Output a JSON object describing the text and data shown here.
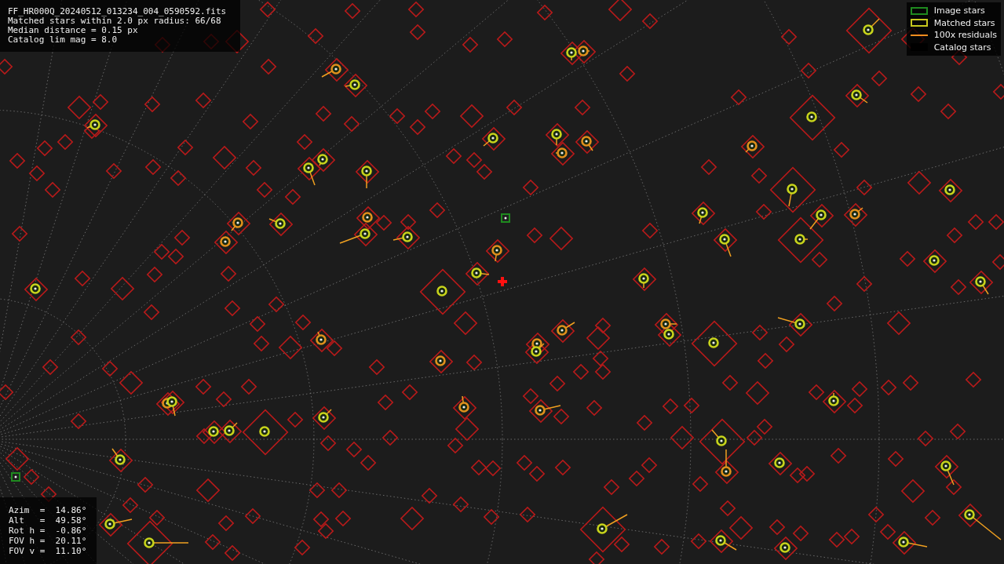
{
  "file_info": [
    "FF_HR000Q_20240512_013234_004_0590592.fits",
    "Matched stars within 2.0 px radius: 66/68",
    "Median distance = 0.15 px",
    "Catalog lim mag = 8.0"
  ],
  "legend": [
    {
      "kind": "box",
      "color": "#1f8a1f",
      "label": "Image stars"
    },
    {
      "kind": "box",
      "color": "#c8c81e",
      "label": "Matched stars"
    },
    {
      "kind": "line",
      "color": "#f08c1e",
      "label": "100x residuals"
    },
    {
      "kind": "blank",
      "color": "#000000",
      "label": "Catalog stars"
    }
  ],
  "pointing": [
    "Azim  =  14.86°",
    "Alt   =  49.58°",
    "Rot h =  -0.86°",
    "FOV h =  20.11°",
    "FOV v =  11.10°"
  ]
}
